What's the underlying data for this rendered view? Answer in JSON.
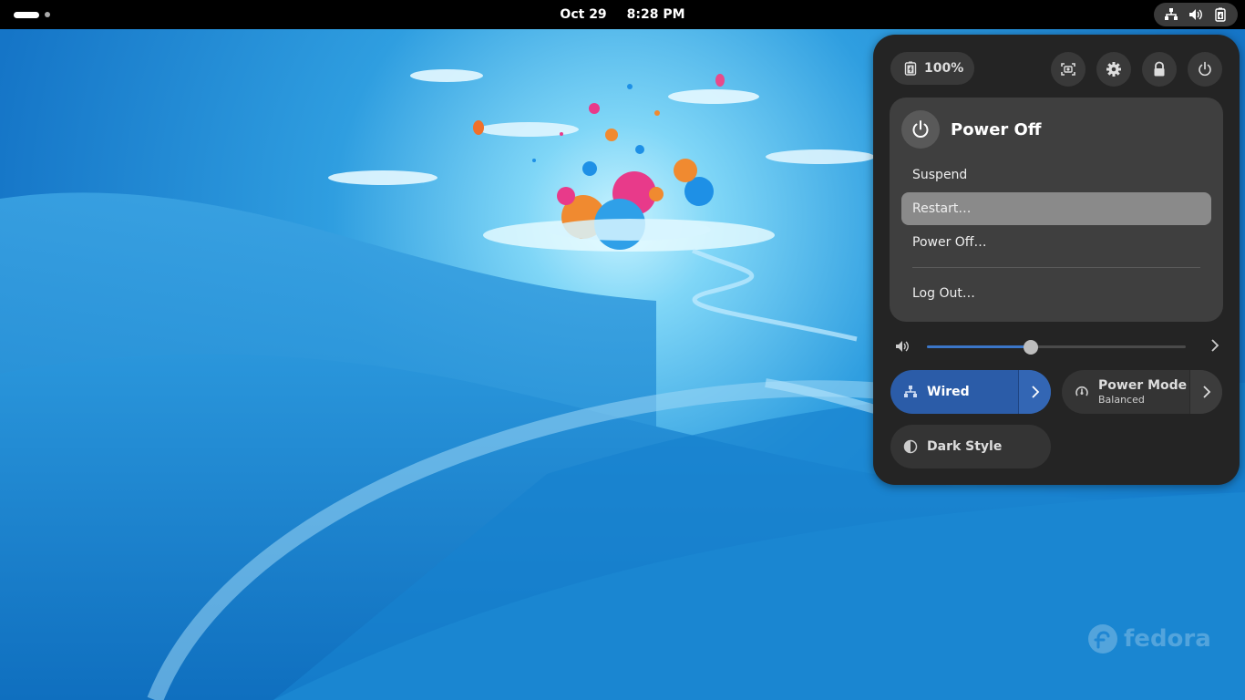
{
  "topbar": {
    "date": "Oct 29",
    "time": "8:28 PM",
    "status_icons": [
      "network-wired-icon",
      "volume-icon",
      "battery-icon"
    ]
  },
  "quick_settings": {
    "battery": {
      "label": "100%",
      "icon": "battery-charging-icon"
    },
    "buttons": [
      {
        "name": "screenshot-button",
        "icon": "screenshot-icon"
      },
      {
        "name": "settings-button",
        "icon": "gear-icon"
      },
      {
        "name": "lock-button",
        "icon": "lock-icon"
      },
      {
        "name": "power-button",
        "icon": "power-icon"
      }
    ],
    "power_menu": {
      "title": "Power Off",
      "items": [
        {
          "label": "Suspend"
        },
        {
          "label": "Restart…"
        },
        {
          "label": "Power Off…"
        },
        {
          "label": "Log Out…"
        }
      ]
    },
    "volume": {
      "level": 0.4
    },
    "tiles": {
      "wired": {
        "label": "Wired",
        "active": true
      },
      "power_mode": {
        "label": "Power Mode",
        "sub": "Balanced"
      },
      "dark_style": {
        "label": "Dark Style"
      }
    }
  },
  "wallpaper": {
    "brand": "fedora"
  },
  "colors": {
    "panel": "#242424",
    "accent": "#3b76c8",
    "wallpaper": "#1a7fce"
  }
}
